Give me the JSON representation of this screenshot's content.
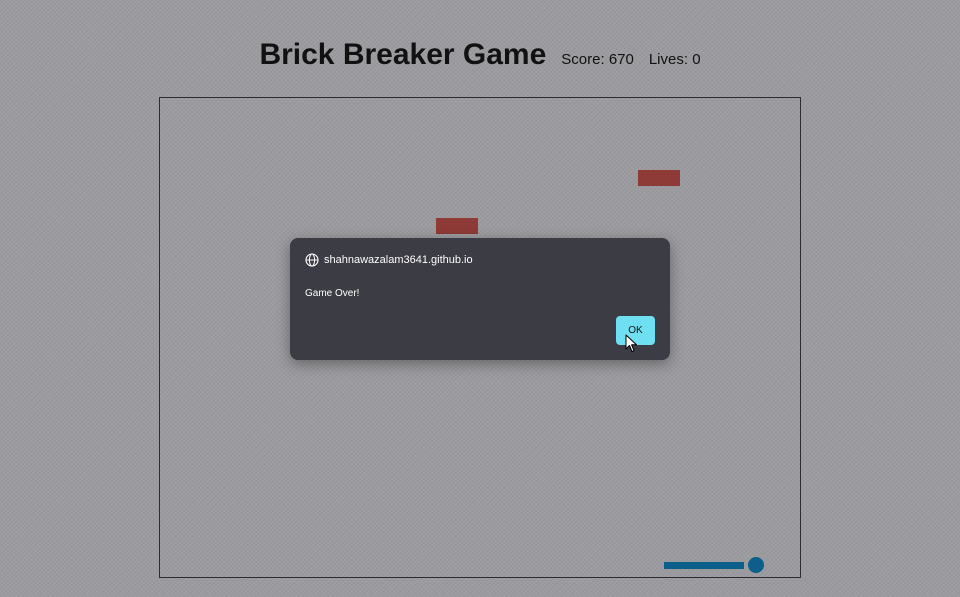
{
  "header": {
    "title": "Brick Breaker Game",
    "score_text": "Score: 670",
    "lives_text": "Lives: 0"
  },
  "game": {
    "score": 670,
    "lives": 0,
    "brick_color": "#8e3a36",
    "paddle_color": "#0b5f8a",
    "ball_color": "#0b5f8a"
  },
  "dialog": {
    "origin": "shahnawazalam3641.github.io",
    "message": "Game Over!",
    "ok_label": "OK",
    "origin_icon": "globe-icon",
    "accent_color": "#6fe0f2"
  }
}
